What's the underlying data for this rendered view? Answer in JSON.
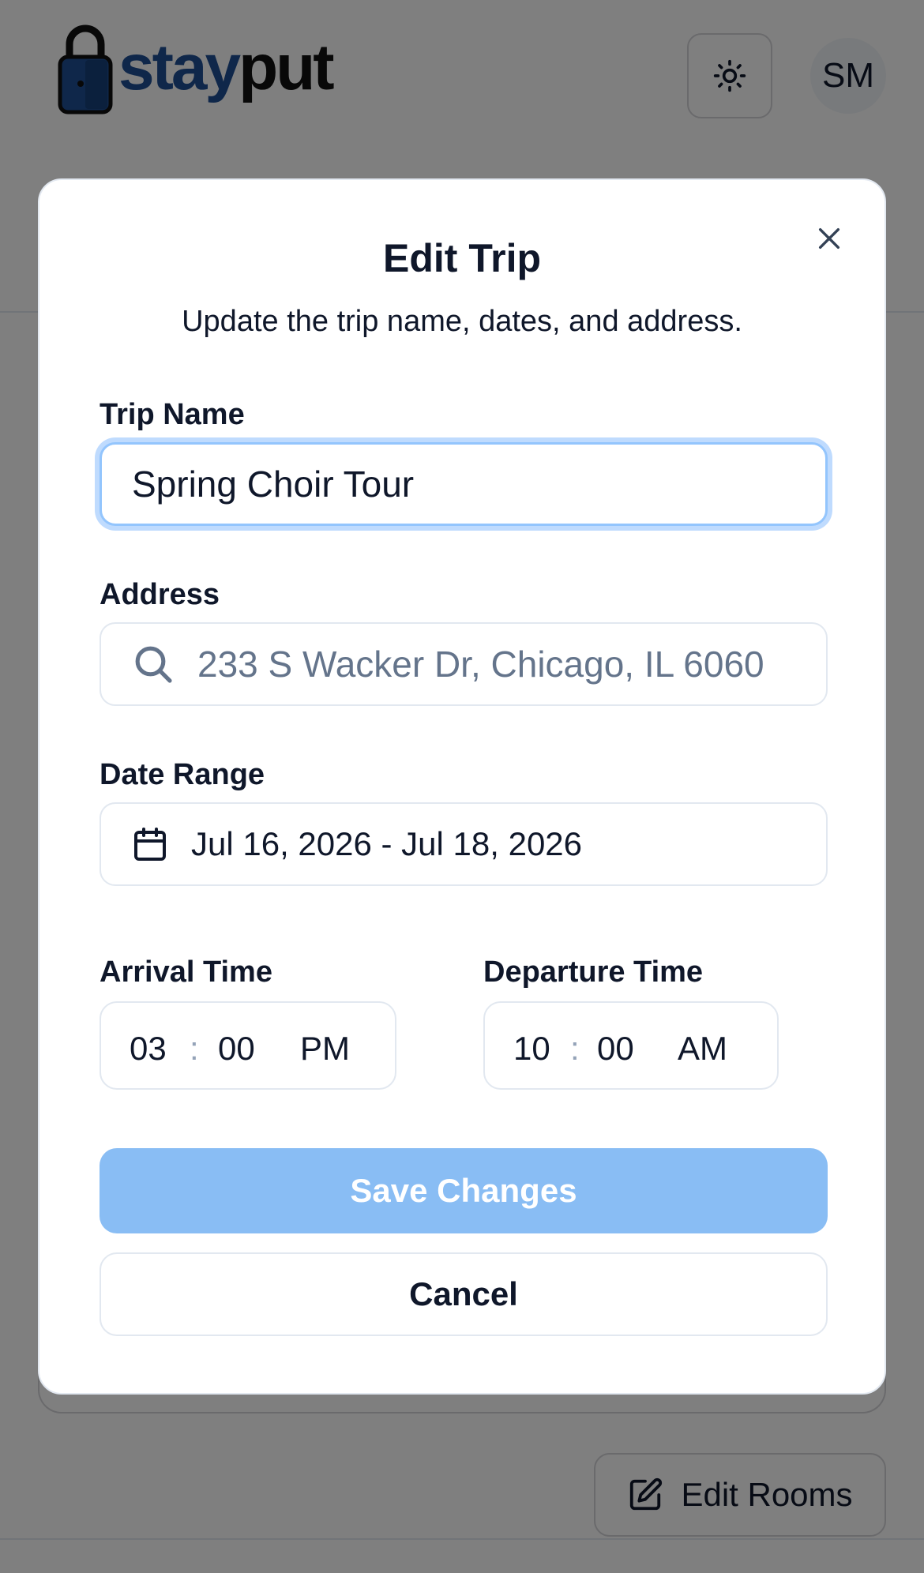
{
  "header": {
    "logo_part1": "stay",
    "logo_part2": "put",
    "avatar_initials": "SM",
    "theme_icon": "sun-icon"
  },
  "page": {
    "edit_rooms_label": "Edit Rooms"
  },
  "modal": {
    "title": "Edit Trip",
    "description": "Update the trip name, dates, and address.",
    "trip_name": {
      "label": "Trip Name",
      "value": "Spring Choir Tour"
    },
    "address": {
      "label": "Address",
      "value": "233 S Wacker Dr, Chicago, IL 6060"
    },
    "date_range": {
      "label": "Date Range",
      "value": "Jul 16, 2026 - Jul 18, 2026"
    },
    "arrival": {
      "label": "Arrival Time",
      "hour": "03",
      "separator": ":",
      "minute": "00",
      "period": "PM"
    },
    "departure": {
      "label": "Departure Time",
      "hour": "10",
      "separator": ":",
      "minute": "00",
      "period": "AM"
    },
    "save_label": "Save Changes",
    "cancel_label": "Cancel"
  },
  "colors": {
    "brand_blue": "#1e4f94",
    "save_disabled": "#89bdf4",
    "focus_ring": "#93c5fd",
    "placeholder": "#64748b"
  }
}
